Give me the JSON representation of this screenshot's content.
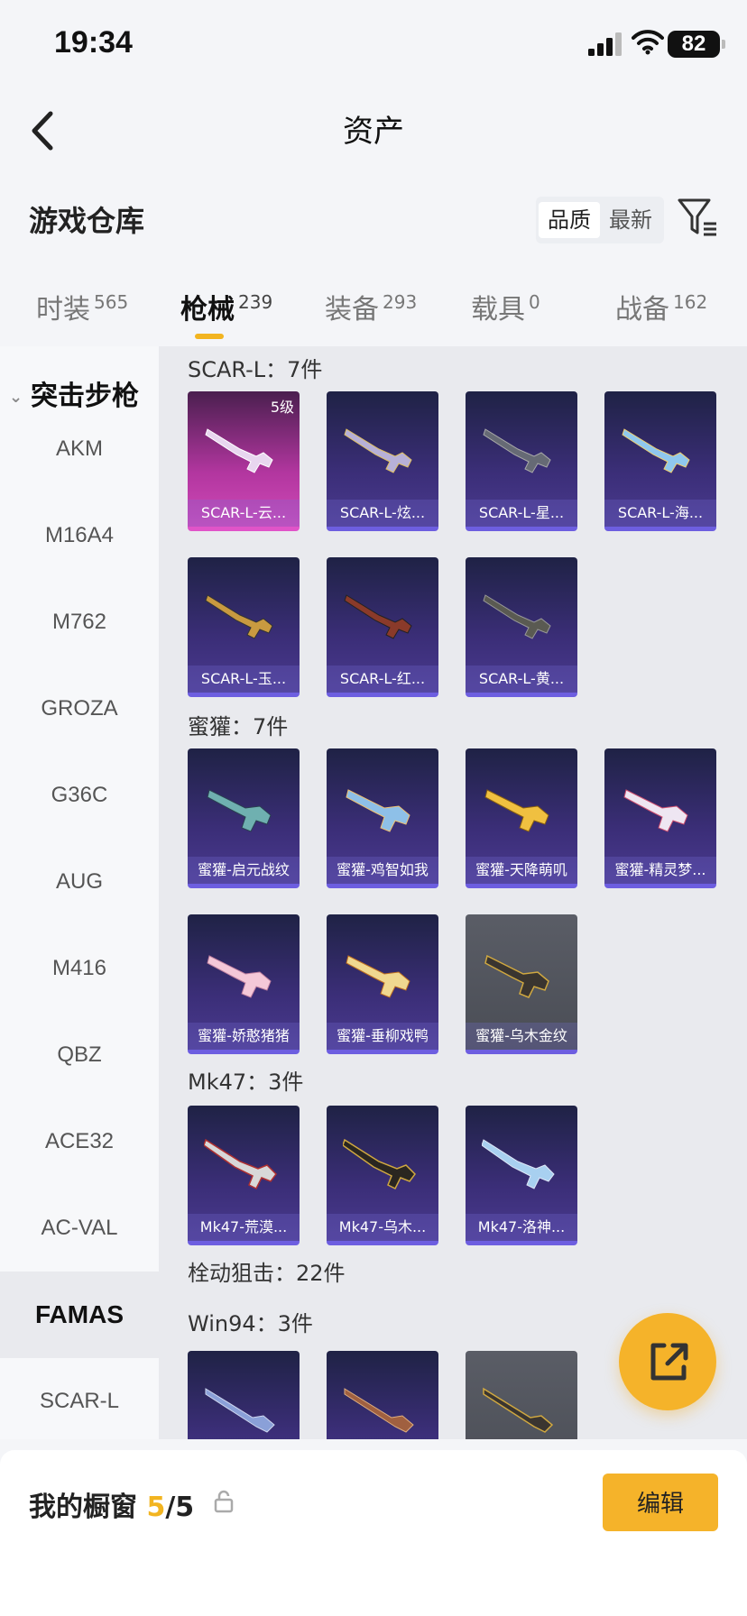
{
  "status_bar": {
    "time": "19:34",
    "battery": "82"
  },
  "nav": {
    "title": "资产"
  },
  "section": {
    "title": "游戏仓库"
  },
  "sort": {
    "quality": "品质",
    "newest": "最新"
  },
  "tabs": [
    {
      "label": "时装",
      "count": "565"
    },
    {
      "label": "枪械",
      "count": "239"
    },
    {
      "label": "装备",
      "count": "293"
    },
    {
      "label": "载具",
      "count": "0"
    },
    {
      "label": "战备",
      "count": "162"
    }
  ],
  "sidebar": {
    "group": "突击步枪",
    "items": [
      "AKM",
      "M16A4",
      "M762",
      "GROZA",
      "G36C",
      "AUG",
      "M416",
      "QBZ",
      "ACE32",
      "AC-VAL",
      "FAMAS",
      "SCAR-L"
    ],
    "active": "FAMAS"
  },
  "groups": [
    {
      "title": "SCAR-L：7件",
      "items": [
        {
          "name": "SCAR-L-云...",
          "level": "5级"
        },
        {
          "name": "SCAR-L-炫..."
        },
        {
          "name": "SCAR-L-星..."
        },
        {
          "name": "SCAR-L-海..."
        },
        {
          "name": "SCAR-L-玉..."
        },
        {
          "name": "SCAR-L-红..."
        },
        {
          "name": "SCAR-L-黄..."
        }
      ]
    },
    {
      "title": "蜜獾：7件",
      "items": [
        {
          "name": "蜜獾-启元战纹"
        },
        {
          "name": "蜜獾-鸡智如我"
        },
        {
          "name": "蜜獾-天降萌叽"
        },
        {
          "name": "蜜獾-精灵梦..."
        },
        {
          "name": "蜜獾-娇憨猪猪"
        },
        {
          "name": "蜜獾-垂柳戏鸭"
        },
        {
          "name": "蜜獾-乌木金纹"
        }
      ]
    },
    {
      "title": "Mk47：3件",
      "items": [
        {
          "name": "Mk47-荒漠..."
        },
        {
          "name": "Mk47-乌木..."
        },
        {
          "name": "Mk47-洛神..."
        }
      ]
    },
    {
      "title": "栓动狙击：22件"
    },
    {
      "title": "Win94：3件"
    }
  ],
  "showcase": {
    "label": "我的橱窗",
    "count": "5",
    "total": "/5",
    "edit": "编辑"
  },
  "colors": {
    "accent": "#f5b32a",
    "card_purple": "#3b2e78",
    "card_pink": "#d04ab8",
    "card_gray": "#4a4d55"
  },
  "icons": {
    "back": "chevron-left-icon",
    "filter": "filter-icon",
    "share": "share-icon",
    "lock": "lock-icon"
  }
}
